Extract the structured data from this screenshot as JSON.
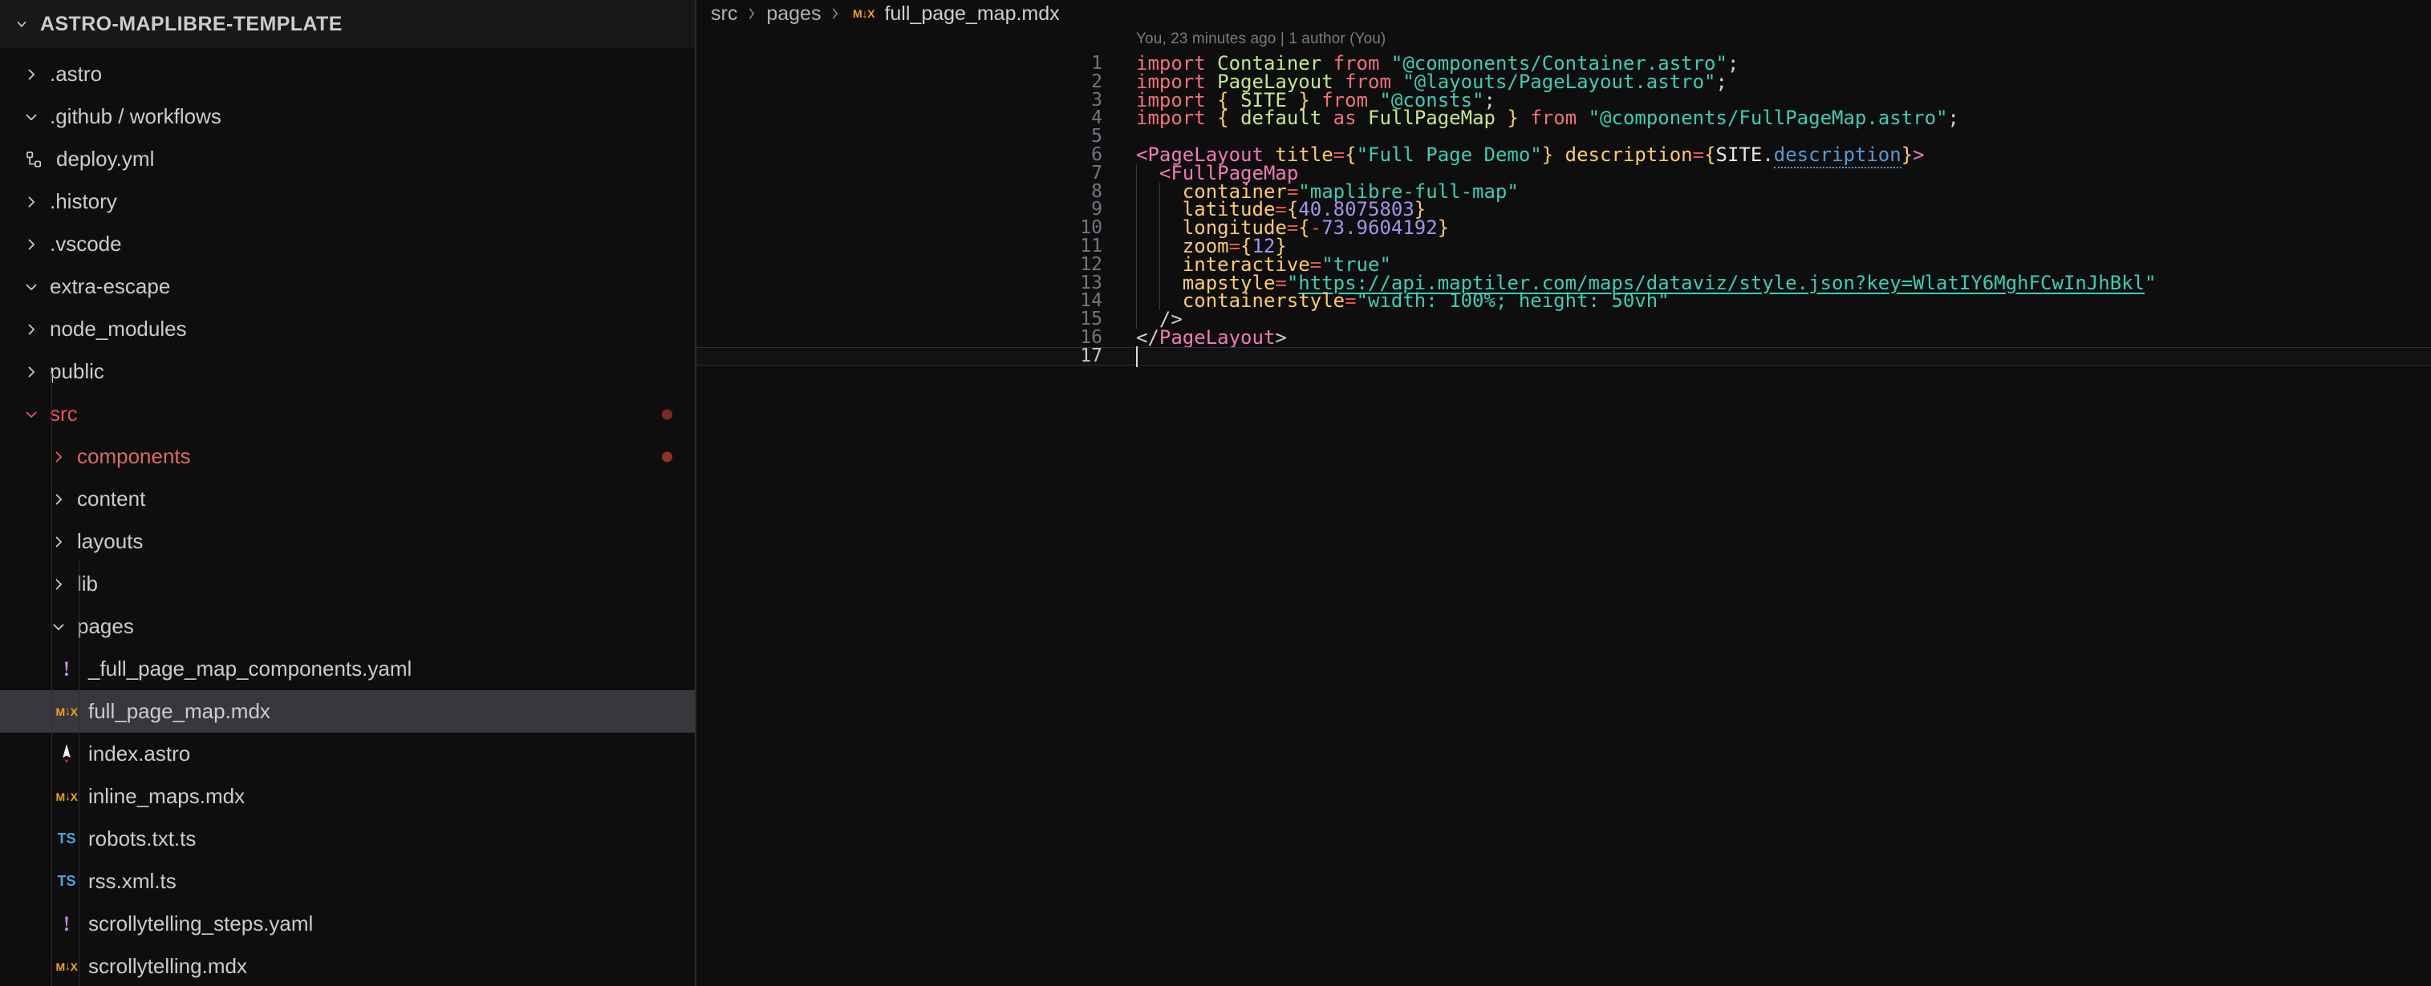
{
  "window": {
    "theme": "dark"
  },
  "sidebar": {
    "title": "ASTRO-MAPLIBRE-TEMPLATE",
    "items": [
      {
        "label": ".astro",
        "kind": "folder",
        "indent": 1,
        "expanded": false,
        "icon": "chevron-right-icon",
        "state": "normal",
        "dot": false,
        "selected": false
      },
      {
        "label": ".github / workflows",
        "kind": "folder",
        "indent": 1,
        "expanded": true,
        "icon": "chevron-down-icon",
        "state": "normal",
        "dot": false,
        "selected": false
      },
      {
        "label": "deploy.yml",
        "kind": "file",
        "indent": 1,
        "expanded": null,
        "icon": "workflow-icon",
        "state": "normal",
        "dot": false,
        "selected": false
      },
      {
        "label": ".history",
        "kind": "folder",
        "indent": 1,
        "expanded": false,
        "icon": "chevron-right-icon",
        "state": "normal",
        "dot": false,
        "selected": false
      },
      {
        "label": ".vscode",
        "kind": "folder",
        "indent": 1,
        "expanded": false,
        "icon": "chevron-right-icon",
        "state": "normal",
        "dot": false,
        "selected": false
      },
      {
        "label": "extra-escape",
        "kind": "folder",
        "indent": 1,
        "expanded": true,
        "icon": "chevron-down-icon",
        "state": "normal",
        "dot": false,
        "selected": false
      },
      {
        "label": "node_modules",
        "kind": "folder",
        "indent": 1,
        "expanded": false,
        "icon": "chevron-right-icon",
        "state": "normal",
        "dot": false,
        "selected": false
      },
      {
        "label": "public",
        "kind": "folder",
        "indent": 1,
        "expanded": false,
        "icon": "chevron-right-icon",
        "state": "normal",
        "dot": false,
        "selected": false
      },
      {
        "label": "src",
        "kind": "folder",
        "indent": 1,
        "expanded": true,
        "icon": "chevron-down-icon",
        "state": "modified",
        "dot": true,
        "selected": false
      },
      {
        "label": "components",
        "kind": "folder",
        "indent": 2,
        "expanded": false,
        "icon": "chevron-right-icon",
        "state": "modified",
        "dot": true,
        "selected": false
      },
      {
        "label": "content",
        "kind": "folder",
        "indent": 2,
        "expanded": false,
        "icon": "chevron-right-icon",
        "state": "normal",
        "dot": false,
        "selected": false
      },
      {
        "label": "layouts",
        "kind": "folder",
        "indent": 2,
        "expanded": false,
        "icon": "chevron-right-icon",
        "state": "normal",
        "dot": false,
        "selected": false
      },
      {
        "label": "lib",
        "kind": "folder",
        "indent": 2,
        "expanded": false,
        "icon": "chevron-right-icon",
        "state": "normal",
        "dot": false,
        "selected": false
      },
      {
        "label": "pages",
        "kind": "folder",
        "indent": 2,
        "expanded": true,
        "icon": "chevron-down-icon",
        "state": "normal",
        "dot": false,
        "selected": false
      },
      {
        "label": "_full_page_map_components.yaml",
        "kind": "file",
        "indent": 3,
        "expanded": null,
        "icon": "yaml-icon",
        "state": "normal",
        "dot": false,
        "selected": false
      },
      {
        "label": "full_page_map.mdx",
        "kind": "file",
        "indent": 3,
        "expanded": null,
        "icon": "mdx-icon",
        "state": "normal",
        "dot": false,
        "selected": true
      },
      {
        "label": "index.astro",
        "kind": "file",
        "indent": 3,
        "expanded": null,
        "icon": "astro-icon",
        "state": "normal",
        "dot": false,
        "selected": false
      },
      {
        "label": "inline_maps.mdx",
        "kind": "file",
        "indent": 3,
        "expanded": null,
        "icon": "mdx-icon",
        "state": "normal",
        "dot": false,
        "selected": false
      },
      {
        "label": "robots.txt.ts",
        "kind": "file",
        "indent": 3,
        "expanded": null,
        "icon": "ts-icon",
        "state": "normal",
        "dot": false,
        "selected": false
      },
      {
        "label": "rss.xml.ts",
        "kind": "file",
        "indent": 3,
        "expanded": null,
        "icon": "ts-icon",
        "state": "normal",
        "dot": false,
        "selected": false
      },
      {
        "label": "scrollytelling_steps.yaml",
        "kind": "file",
        "indent": 3,
        "expanded": null,
        "icon": "yaml-icon",
        "state": "normal",
        "dot": false,
        "selected": false
      },
      {
        "label": "scrollytelling.mdx",
        "kind": "file",
        "indent": 3,
        "expanded": null,
        "icon": "mdx-icon",
        "state": "normal",
        "dot": false,
        "selected": false
      }
    ]
  },
  "editor": {
    "breadcrumb": {
      "root": "src",
      "folder": "pages",
      "file": "full_page_map.mdx",
      "file_icon": "mdx-icon",
      "separator": "›"
    },
    "blame": "You, 23 minutes ago | 1 author (You)",
    "current_line": 17,
    "total_lines": 17,
    "lines": [
      {
        "n": "1",
        "raw": "import Container from \"@components/Container.astro\";"
      },
      {
        "n": "2",
        "raw": "import PageLayout from \"@layouts/PageLayout.astro\";"
      },
      {
        "n": "3",
        "raw": "import { SITE } from \"@consts\";"
      },
      {
        "n": "4",
        "raw": "import { default as FullPageMap } from \"@components/FullPageMap.astro\";"
      },
      {
        "n": "5",
        "raw": ""
      },
      {
        "n": "6",
        "raw": "<PageLayout title={\"Full Page Demo\"} description={SITE.description}>"
      },
      {
        "n": "7",
        "raw": "  <FullPageMap"
      },
      {
        "n": "8",
        "raw": "    container=\"maplibre-full-map\""
      },
      {
        "n": "9",
        "raw": "    latitude={40.8075803}"
      },
      {
        "n": "10",
        "raw": "    longitude={-73.9604192}"
      },
      {
        "n": "11",
        "raw": "    zoom={12}"
      },
      {
        "n": "12",
        "raw": "    interactive=\"true\""
      },
      {
        "n": "13",
        "raw": "    mapstyle=\"https://api.maptiler.com/maps/dataviz/style.json?key=WlatIY6MghFCwInJhBkl\""
      },
      {
        "n": "14",
        "raw": "    containerstyle=\"width: 100%; height: 50vh\""
      },
      {
        "n": "15",
        "raw": "  />"
      },
      {
        "n": "16",
        "raw": "</PageLayout>"
      },
      {
        "n": "17",
        "raw": ""
      }
    ],
    "code_values": {
      "container": "maplibre-full-map",
      "latitude": "40.8075803",
      "longitude": "-73.9604192",
      "zoom": "12",
      "interactive": "true",
      "mapstyle": "https://api.maptiler.com/maps/dataviz/style.json?key=WlatIY6MghFCwInJhBkl",
      "containerstyle": "width: 100%; height: 50vh",
      "page_title": "Full Page Demo"
    }
  },
  "colors": {
    "background": "#0e0e0e",
    "sidebar_title_bg": "#181818",
    "selection": "#37373d",
    "keyword": "#f07178",
    "identifier": "#c3e88d",
    "string": "#3ecdb4",
    "number": "#a393eb",
    "tag": "#f07bb3",
    "attribute": "#ffcb6b",
    "modified": "#e2574c",
    "mdx_icon": "#f0a020",
    "ts_icon": "#4aa8e0",
    "yaml_icon": "#c586e0"
  }
}
